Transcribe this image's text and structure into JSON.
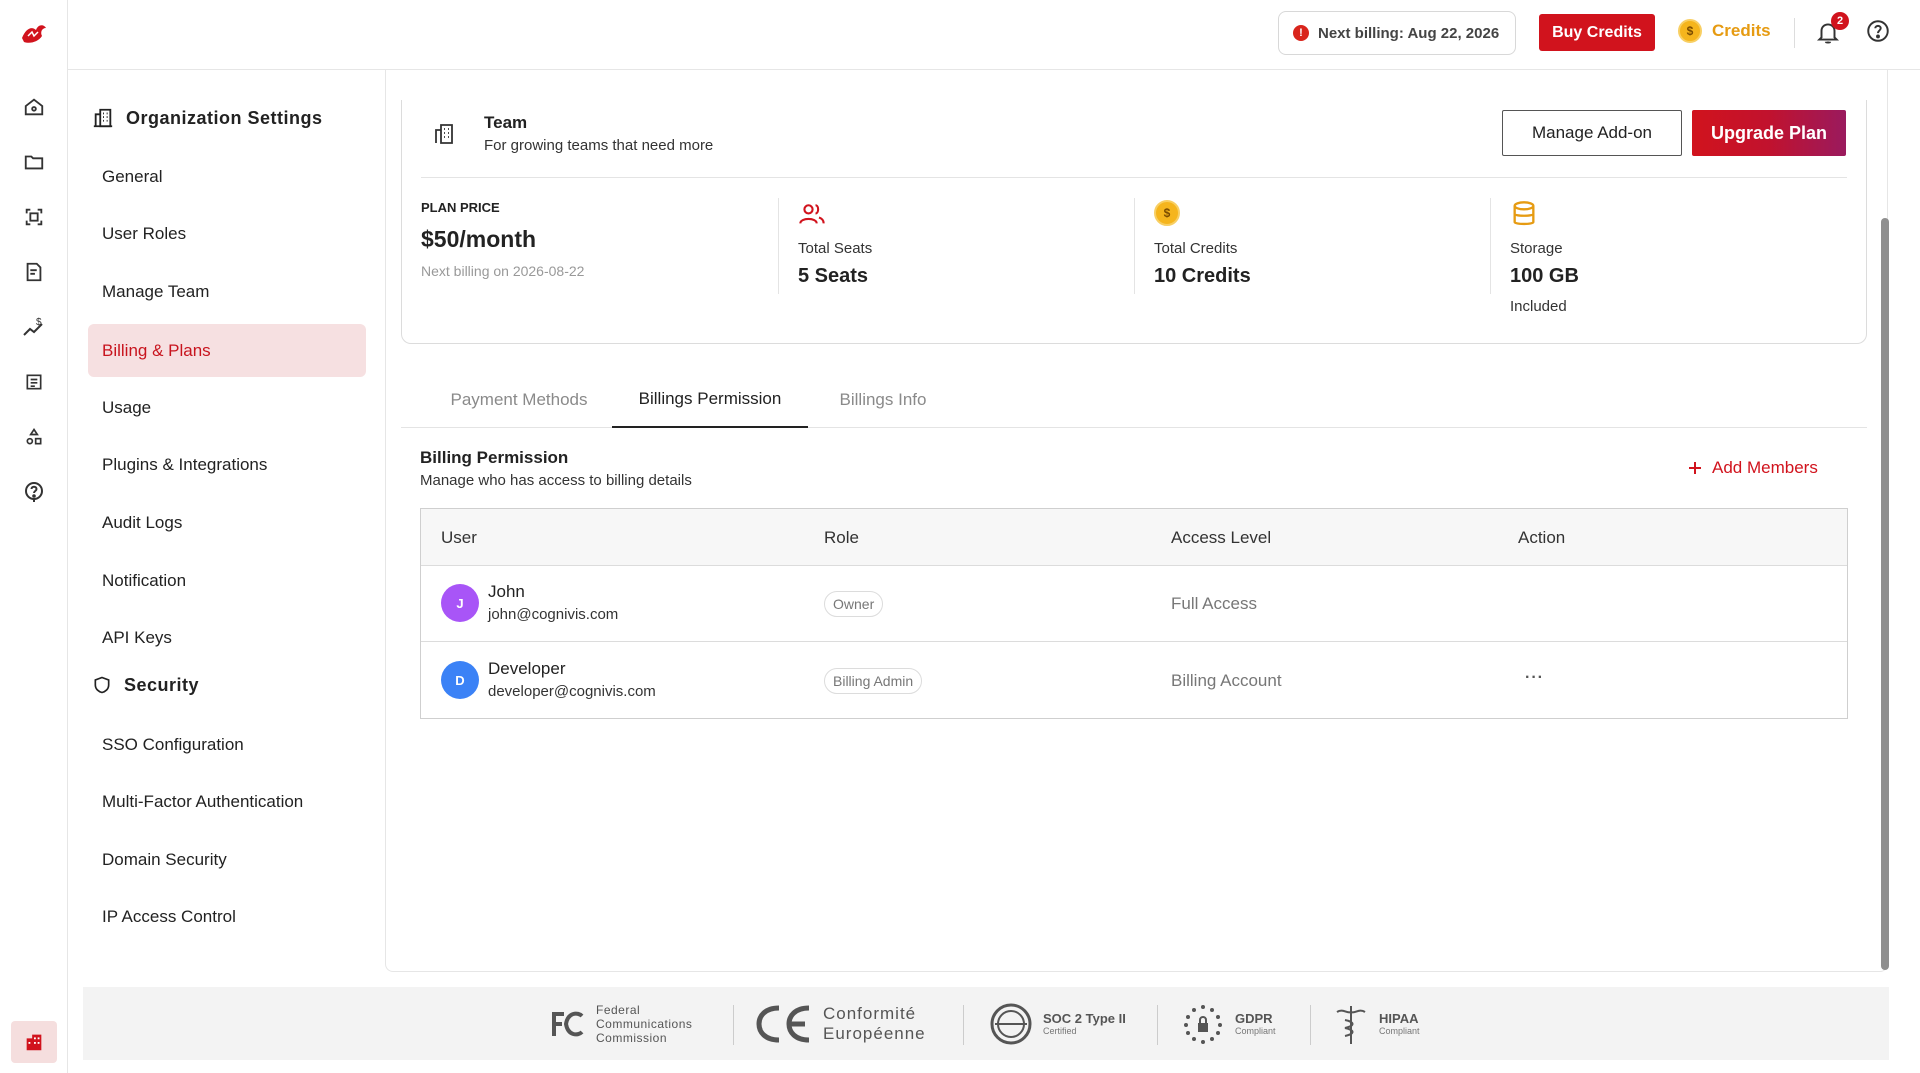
{
  "topbar": {
    "billing_notice": "Next billing: Aug 22, 2026",
    "buy_credits": "Buy Credits",
    "credits_label": "Credits",
    "coin_symbol": "$",
    "notification_count": "2"
  },
  "sidebar": {
    "org_title": "Organization Settings",
    "items": [
      {
        "label": "General"
      },
      {
        "label": "User Roles"
      },
      {
        "label": "Manage Team"
      },
      {
        "label": "Billing & Plans"
      },
      {
        "label": "Usage"
      },
      {
        "label": "Plugins & Integrations"
      },
      {
        "label": "Audit Logs"
      },
      {
        "label": "Notification"
      },
      {
        "label": "API Keys"
      }
    ],
    "security_title": "Security",
    "security_items": [
      {
        "label": "SSO Configuration"
      },
      {
        "label": "Multi-Factor Authentication"
      },
      {
        "label": "Domain Security"
      },
      {
        "label": "IP Access Control"
      }
    ],
    "active_item": "Billing & Plans"
  },
  "plan": {
    "name": "Team",
    "description": "For growing teams that need more",
    "manage_addon": "Manage Add-on",
    "upgrade": "Upgrade Plan",
    "price_label": "PLAN PRICE",
    "price": "$50/month",
    "next_billing": "Next billing on 2026-08-22",
    "seats_label": "Total Seats",
    "seats_value": "5 Seats",
    "credits_label": "Total Credits",
    "credits_value": "10 Credits",
    "storage_label": "Storage",
    "storage_value": "100 GB",
    "storage_sub": "Included"
  },
  "tabs": [
    {
      "label": "Payment Methods"
    },
    {
      "label": "Billings Permission"
    },
    {
      "label": "Billings Info"
    }
  ],
  "active_tab": "Billings Permission",
  "permission": {
    "title": "Billing Permission",
    "subtitle": "Manage who has access to billing details",
    "add_members": "Add Members",
    "columns": [
      "User",
      "Role",
      "Access Level",
      "Action"
    ],
    "rows": [
      {
        "initial": "J",
        "name": "John",
        "email": "john@cognivis.com",
        "role": "Owner",
        "access": "Full Access",
        "action": "",
        "avatar_color": "#a855f7"
      },
      {
        "initial": "D",
        "name": "Developer",
        "email": "developer@cognivis.com",
        "role": "Billing Admin",
        "access": "Billing Account",
        "action": "···",
        "avatar_color": "#3b82f6"
      }
    ]
  },
  "footer": {
    "fcc_lines": [
      "Federal",
      "Communications",
      "Commission"
    ],
    "ce_lines": [
      "Conformité",
      "Européenne"
    ],
    "soc_title": "SOC 2 Type II",
    "soc_sub": "Certified",
    "gdpr_title": "GDPR",
    "gdpr_sub": "Compliant",
    "hipaa_title": "HIPAA",
    "hipaa_sub": "Compliant"
  },
  "colors": {
    "brand_red": "#d1131d",
    "active_bg": "#f6e0e1",
    "credits_gold": "#e69b12"
  }
}
